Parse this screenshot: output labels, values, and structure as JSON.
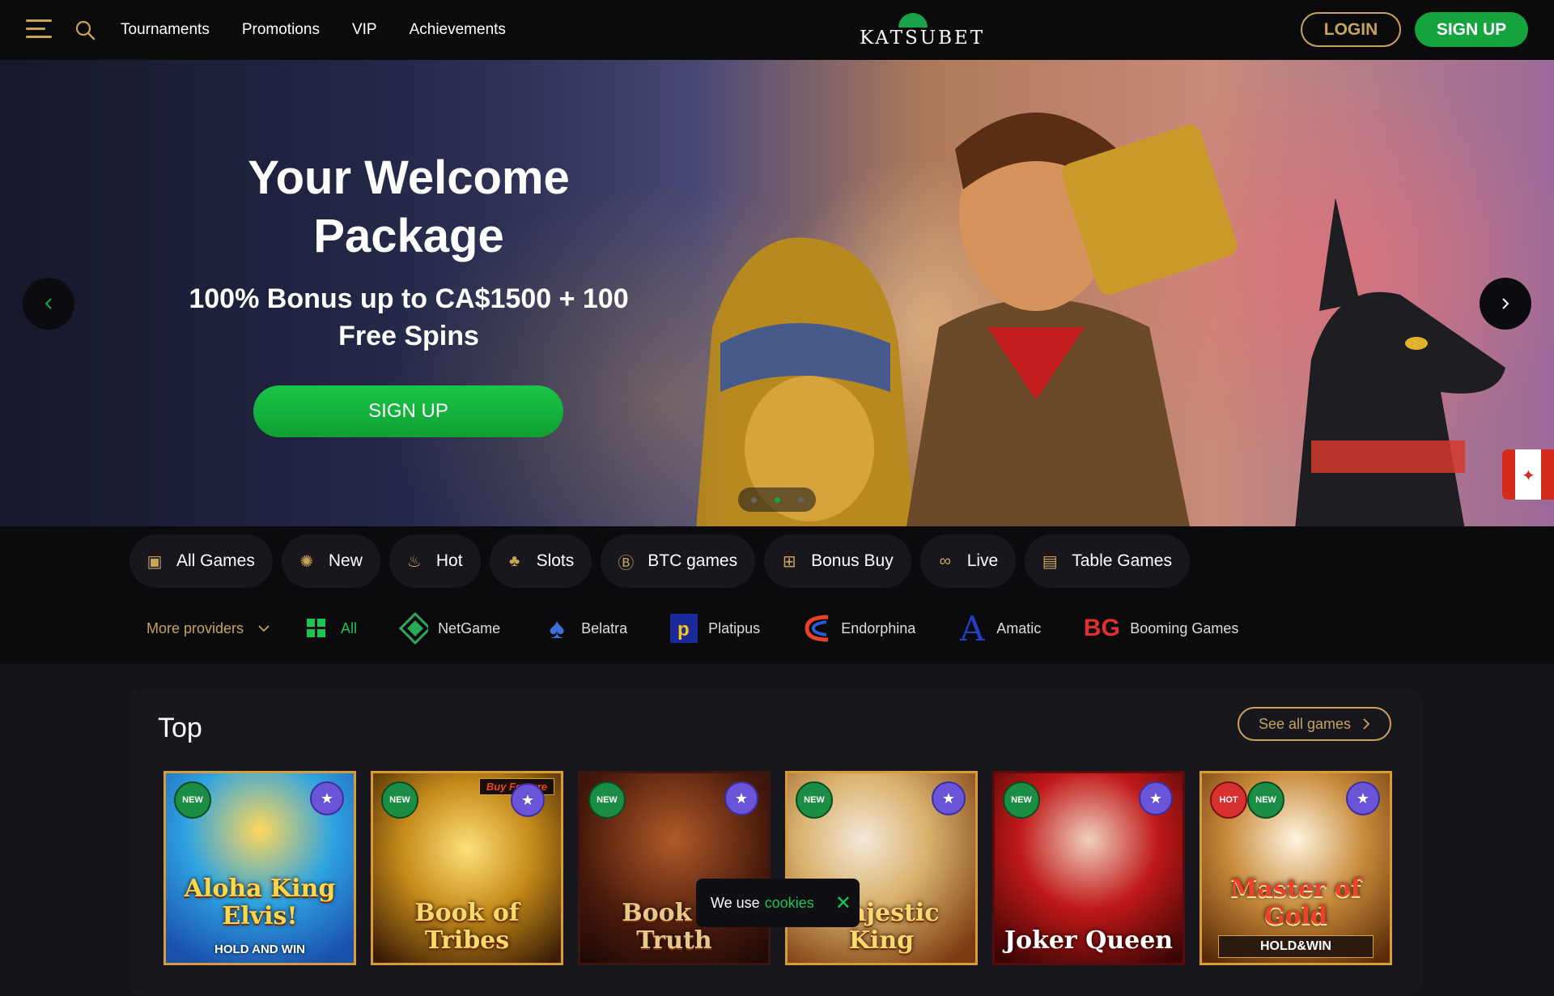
{
  "header": {
    "nav": [
      "Tournaments",
      "Promotions",
      "VIP",
      "Achievements"
    ],
    "logo_text": "KATSUBET",
    "login_label": "LOGIN",
    "signup_label": "SIGN UP"
  },
  "hero": {
    "title": "Your Welcome Package",
    "subtitle": "100% Bonus up to CA$1500 + 100 Free Spins",
    "cta_label": "SIGN UP",
    "slide_count": 3,
    "active_slide": 2
  },
  "categories": [
    {
      "label": "All Games",
      "icon": "slot-machine-icon"
    },
    {
      "label": "New",
      "icon": "new-badge-icon"
    },
    {
      "label": "Hot",
      "icon": "flame-icon"
    },
    {
      "label": "Slots",
      "icon": "cherries-icon"
    },
    {
      "label": "BTC games",
      "icon": "bitcoin-icon"
    },
    {
      "label": "Bonus Buy",
      "icon": "gift-icon"
    },
    {
      "label": "Live",
      "icon": "glasses-icon"
    },
    {
      "label": "Table Games",
      "icon": "cards-icon"
    }
  ],
  "providers": {
    "more_label": "More providers",
    "items": [
      "All",
      "NetGame",
      "Belatra",
      "Platipus",
      "Endorphina",
      "Amatic",
      "Booming Games"
    ]
  },
  "top": {
    "title": "Top",
    "see_all_label": "See all games",
    "games": [
      {
        "name": "Aloha King Elvis!",
        "caption": "HOLD AND WIN",
        "badges": [
          "NEW"
        ]
      },
      {
        "name": "Book of Tribes",
        "caption": "Buy Feature",
        "badges": [
          "NEW"
        ]
      },
      {
        "name": "Book of Truth",
        "caption": "",
        "badges": [
          "NEW"
        ]
      },
      {
        "name": "Majestic King",
        "caption": "",
        "badges": [
          "NEW"
        ]
      },
      {
        "name": "Joker Queen",
        "caption": "",
        "badges": [
          "NEW"
        ]
      },
      {
        "name": "Master of Gold",
        "caption": "HOLD&WIN",
        "badges": [
          "HOT",
          "NEW"
        ]
      }
    ]
  },
  "cookie": {
    "text": "We use",
    "link": "cookies"
  },
  "colors": {
    "gold": "#c8a45a",
    "green": "#14a33d",
    "background": "#0b0b0e"
  }
}
